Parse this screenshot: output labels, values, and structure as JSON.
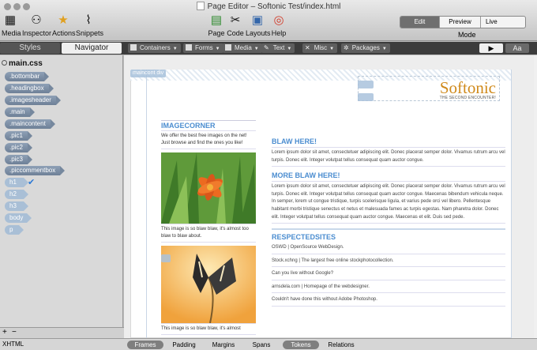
{
  "window": {
    "title": "Page Editor – Softonic Test/index.html"
  },
  "toolbar_left": [
    {
      "label": "Media",
      "icon": "media-icon"
    },
    {
      "label": "Inspector",
      "icon": "binoculars-icon"
    },
    {
      "label": "Actions",
      "icon": "star-icon"
    },
    {
      "label": "Snippets",
      "icon": "paperclip-icon"
    }
  ],
  "toolbar_center": [
    {
      "label": "Page",
      "icon": "page-icon"
    },
    {
      "label": "Code",
      "icon": "code-icon"
    },
    {
      "label": "Layouts",
      "icon": "layouts-icon"
    },
    {
      "label": "Help",
      "icon": "lifebuoy-icon"
    }
  ],
  "mode": {
    "label": "Mode",
    "options": [
      "Edit",
      "Preview",
      "Live Preview"
    ],
    "selected": "Edit"
  },
  "panel_tabs": [
    "Styles",
    "Navigator"
  ],
  "palettes": [
    "Containers",
    "Forms",
    "Media",
    "Text",
    "Misc",
    "Packages"
  ],
  "tools": {
    "pointer": "▶",
    "text": "Aa"
  },
  "stylesheet": {
    "file": "main.css",
    "selectors": [
      ".bottombar",
      ".headingbox",
      ".imagesheader",
      ".main",
      ".maincontent",
      ".pic1",
      ".pic2",
      ".pic3",
      ".piccommentbox",
      "h1",
      "h2",
      "h3",
      "body",
      "p"
    ],
    "checked": "h1"
  },
  "sidebar_footer": {
    "add": "+",
    "remove": "−"
  },
  "statusbar": {
    "format": "XHTML",
    "buttons": [
      "Frames",
      "Padding",
      "Margins",
      "Spans",
      "Tokens",
      "Relations"
    ],
    "active": [
      "Frames",
      "Tokens"
    ]
  },
  "page": {
    "main_tag": "maincont div",
    "logo": {
      "name": "Softonic",
      "tagline": "THE SECOND ENCOUNTER!"
    },
    "left": {
      "heading": "IMAGECORNER",
      "intro": "We offer the best free images on the net! Just browse and find the ones you like!",
      "caption1": "This image is so blaw blaw, it's almost too blaw to blaw about.",
      "caption2": "This image is so blaw blaw, it's almost"
    },
    "right": {
      "h1": "BLAW HERE!",
      "p1": "Lorem ipsum dolor sit amet, consectetuer adipiscing elit. Donec placerat semper dolor. Vivamus rutrum arcu vel turpis. Donec elit. Integer volutpat tellus consequat quam auctor congue.",
      "h2": "MORE BLAW HERE!",
      "p2": "Lorem ipsum dolor sit amet, consectetuer adipiscing elit. Donec placerat semper dolor. Vivamus rutrum arcu vel turpis. Donec elit. Integer volutpat tellus consequat quam auctor congue. Maecenas bibendum vehicula neque. In semper, lorem ut congue tristique, turpis scelerisque ligula, et varius pede orci vel libero. Pellentesque habitant morbi tristique senectus et netus et malesuada fames ac turpis egestas. Nam pharetra dolor. Donec elit. Integer volutpat tellus consequat quam auctor congue. Maecenas et elit. Duis sed pede.",
      "links_heading": "RESPECTEDSITES",
      "links": [
        "OSWD | OpenSource WebDesign.",
        "Stock.xchng | The largest free online stockphotocollection.",
        "Can you live without Google?",
        "arnsdela.com | Homepage of the webdesigner.",
        "Couldn't have done this without Adobe Photoshop."
      ]
    }
  }
}
